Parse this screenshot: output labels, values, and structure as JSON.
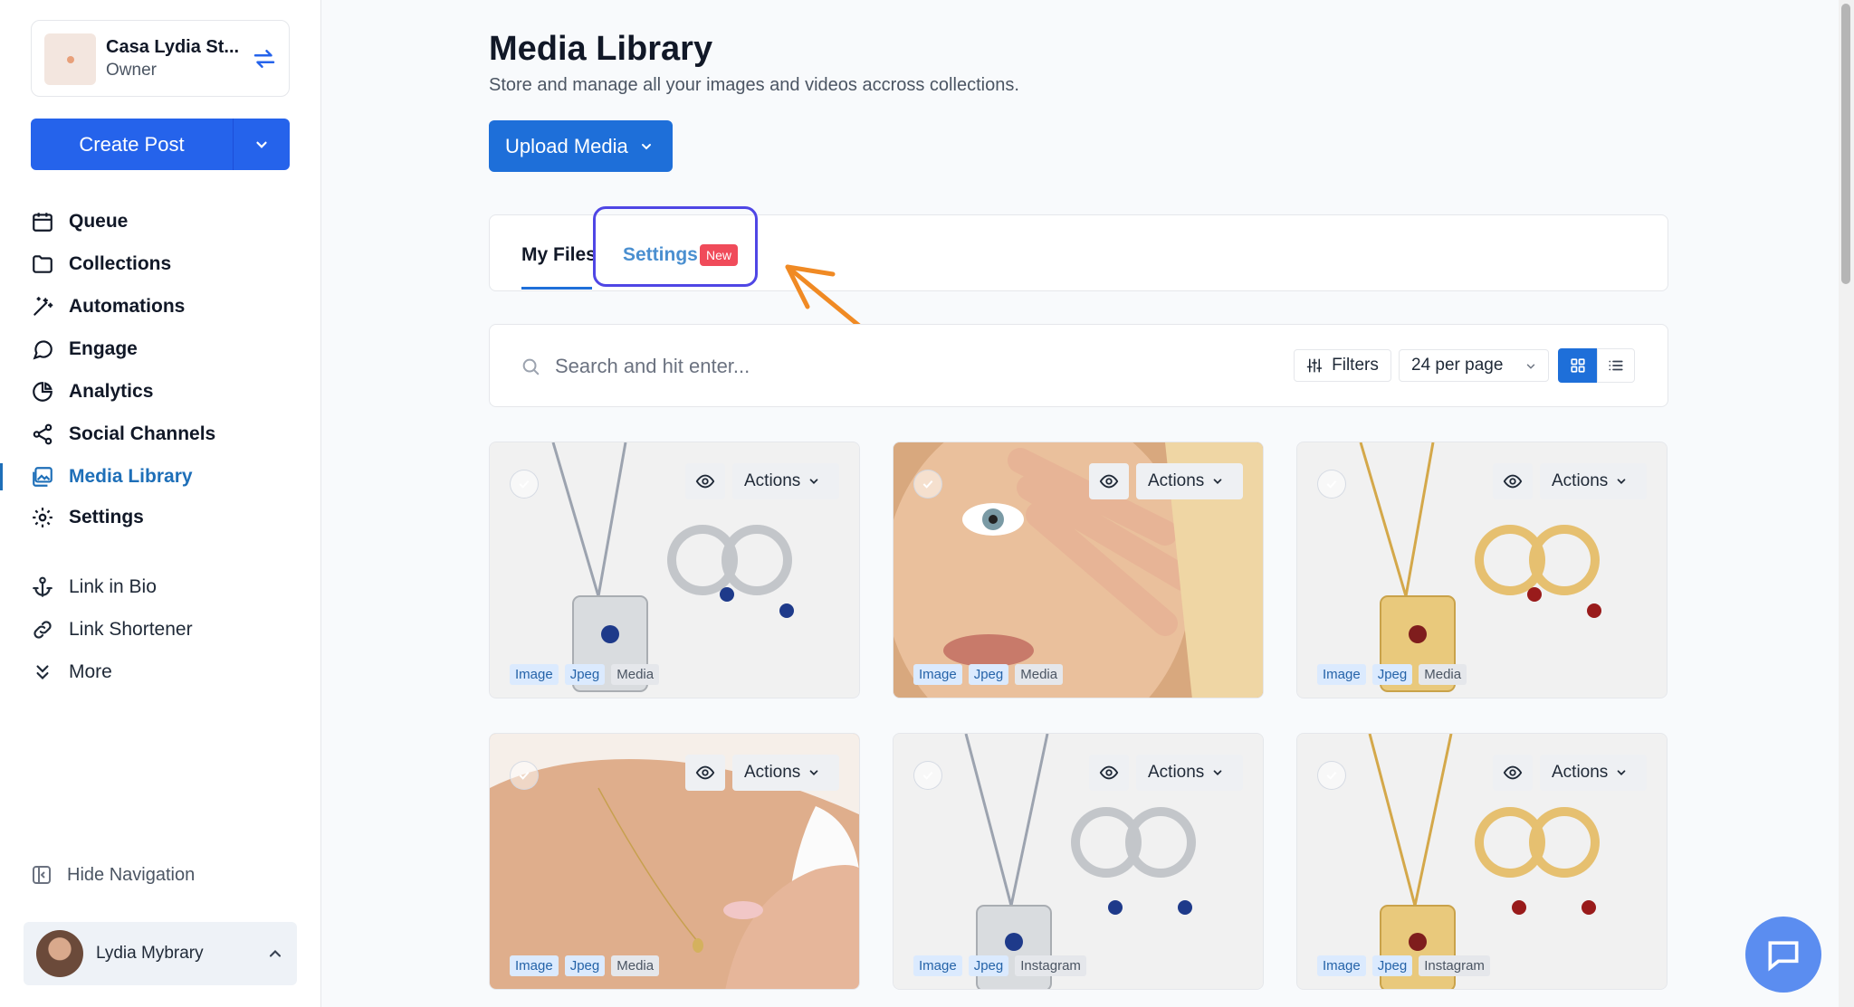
{
  "account": {
    "name": "Casa Lydia St...",
    "role": "Owner"
  },
  "create_post": {
    "label": "Create Post"
  },
  "nav": {
    "primary": [
      {
        "label": "Queue",
        "icon": "calendar-icon"
      },
      {
        "label": "Collections",
        "icon": "folder-icon"
      },
      {
        "label": "Automations",
        "icon": "magic-wand-icon"
      },
      {
        "label": "Engage",
        "icon": "chat-bubble-icon"
      },
      {
        "label": "Analytics",
        "icon": "pie-chart-icon"
      },
      {
        "label": "Social Channels",
        "icon": "share-icon"
      },
      {
        "label": "Media Library",
        "icon": "image-gallery-icon",
        "active": true
      },
      {
        "label": "Settings",
        "icon": "gear-icon"
      }
    ],
    "secondary": [
      {
        "label": "Link in Bio",
        "icon": "anchor-icon"
      },
      {
        "label": "Link Shortener",
        "icon": "link-icon"
      },
      {
        "label": "More",
        "icon": "double-chevron-down-icon"
      }
    ],
    "hide_navigation": "Hide Navigation"
  },
  "user": {
    "name": "Lydia Mybrary"
  },
  "page": {
    "title": "Media Library",
    "subtitle": "Store and manage all your images and videos accross collections.",
    "upload_label": "Upload Media"
  },
  "tabs": {
    "my_files": "My Files",
    "settings": "Settings",
    "new_badge": "New"
  },
  "toolbar": {
    "search_placeholder": "Search and hit enter...",
    "filters_label": "Filters",
    "per_page_value": "24 per page"
  },
  "media_items": [
    {
      "actions_label": "Actions",
      "tags": [
        "Image",
        "Jpeg",
        "Media"
      ]
    },
    {
      "actions_label": "Actions",
      "tags": [
        "Image",
        "Jpeg",
        "Media"
      ]
    },
    {
      "actions_label": "Actions",
      "tags": [
        "Image",
        "Jpeg",
        "Media"
      ]
    },
    {
      "actions_label": "Actions",
      "tags": [
        "Image",
        "Jpeg",
        "Media"
      ]
    },
    {
      "actions_label": "Actions",
      "tags": [
        "Image",
        "Jpeg",
        "Instagram"
      ]
    },
    {
      "actions_label": "Actions",
      "tags": [
        "Image",
        "Jpeg",
        "Instagram"
      ]
    }
  ],
  "colors": {
    "primary": "#2563eb",
    "active_nav": "#1e6fb8",
    "highlight_box": "#4f46e5",
    "annotation_arrow": "#f08a24",
    "new_badge": "#f04b5a"
  }
}
